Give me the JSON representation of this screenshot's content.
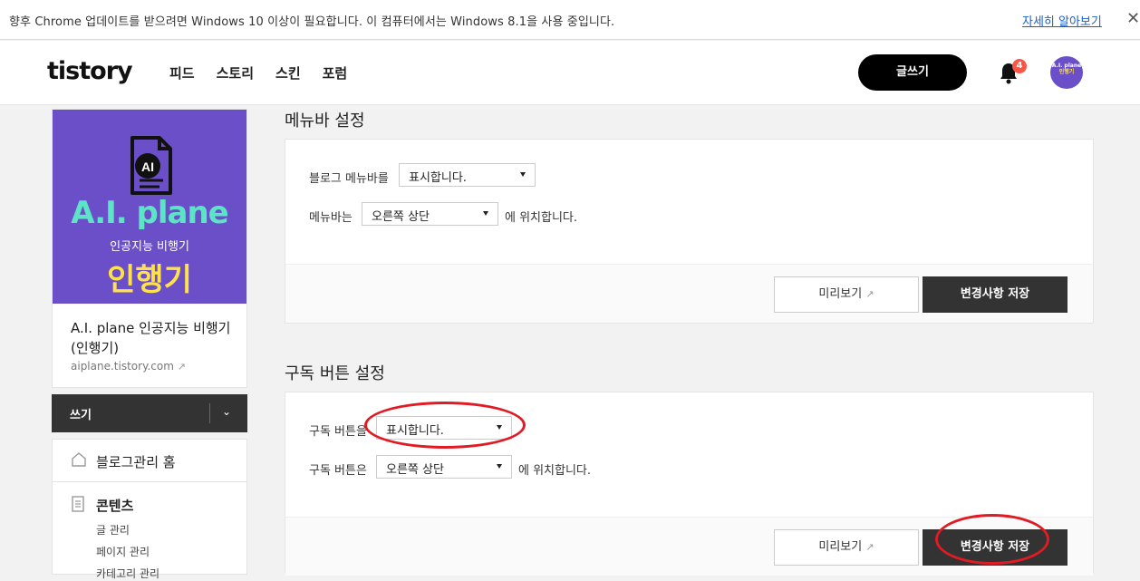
{
  "infobar": {
    "message": "향후 Chrome 업데이트를 받으려면 Windows 10 이상이 필요합니다. 이 컴퓨터에서는 Windows 8.1을 사용 중입니다.",
    "link": "자세히 알아보기",
    "close": "✕"
  },
  "header": {
    "logo": "tistory",
    "nav": [
      "피드",
      "스토리",
      "스킨",
      "포럼"
    ],
    "write_button": "글쓰기",
    "notification_count": "4",
    "avatar_line1": "A.I. plane",
    "avatar_line2": "인행기"
  },
  "blog": {
    "thumb_badge": "AI",
    "thumb_title": "A.I. plane",
    "thumb_subtitle": "인공지능 비행기",
    "thumb_big": "인행기",
    "name": "A.I. plane 인공지능 비행기 (인행기)",
    "url": "aiplane.tistory.com"
  },
  "sidebar": {
    "write_label": "쓰기",
    "home": "블로그관리 홈",
    "content": "콘텐츠",
    "sub_items": [
      "글 관리",
      "페이지 관리",
      "카테고리 관리"
    ]
  },
  "menubar_section": {
    "title": "메뉴바 설정",
    "row1_label": "블로그 메뉴바를",
    "row1_value": "표시합니다.",
    "row2_label": "메뉴바는",
    "row2_value": "오른쪽 상단",
    "row2_after": "에 위치합니다.",
    "preview_button": "미리보기",
    "save_button": "변경사항 저장"
  },
  "subscribe_section": {
    "title": "구독 버튼 설정",
    "row1_label": "구독 버튼을",
    "row1_value": "표시합니다.",
    "row2_label": "구독 버튼은",
    "row2_value": "오른쪽 상단",
    "row2_after": "에 위치합니다.",
    "preview_button": "미리보기",
    "save_button": "변경사항 저장"
  },
  "colors": {
    "accent_purple": "#6a4fc9",
    "thumb_title": "#5de4c7",
    "thumb_big": "#ffe14a",
    "annotation_red": "#e01b24",
    "badge_red": "#ff5544"
  }
}
